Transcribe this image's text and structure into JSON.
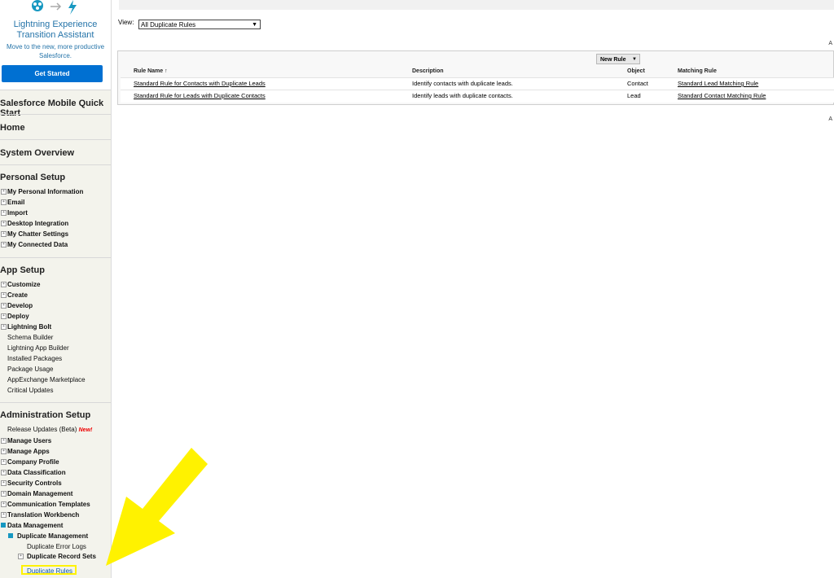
{
  "sidebar": {
    "promo": {
      "title_line1": "Lightning Experience",
      "title_line2": "Transition Assistant",
      "desc_line1": "Move to the new, more productive",
      "desc_line2": "Salesforce.",
      "button": "Get Started"
    },
    "sections": {
      "mobile": "Salesforce Mobile Quick Start",
      "home": "Home",
      "overview": "System Overview",
      "personal": "Personal Setup",
      "app": "App Setup",
      "admin": "Administration Setup"
    },
    "personal_items": [
      "My Personal Information",
      "Email",
      "Import",
      "Desktop Integration",
      "My Chatter Settings",
      "My Connected Data"
    ],
    "app_items": [
      "Customize",
      "Create",
      "Develop",
      "Deploy",
      "Lightning Bolt",
      "Schema Builder",
      "Lightning App Builder",
      "Installed Packages",
      "Package Usage",
      "AppExchange Marketplace",
      "Critical Updates"
    ],
    "admin_items": [
      "Release Updates (Beta)",
      "Manage Users",
      "Manage Apps",
      "Company Profile",
      "Data Classification",
      "Security Controls",
      "Domain Management",
      "Communication Templates",
      "Translation Workbench",
      "Data Management"
    ],
    "new_tag": "New!",
    "dup_mgmt": "Duplicate Management",
    "dup_items": [
      "Duplicate Error Logs",
      "Duplicate Record Sets",
      "Duplicate Rules"
    ]
  },
  "main": {
    "view_label": "View:",
    "view_value": "All Duplicate Rules",
    "corner_a": "A",
    "new_rule": "New Rule",
    "columns": [
      "Rule Name ↑",
      "Description",
      "Object",
      "Matching Rule"
    ],
    "rows": [
      {
        "name": "Standard Rule for Contacts with Duplicate Leads",
        "desc": "Identify contacts with duplicate leads.",
        "object": "Contact",
        "matching": "Standard Lead Matching Rule"
      },
      {
        "name": "Standard Rule for Leads with Duplicate Contacts",
        "desc": "Identify leads with duplicate contacts.",
        "object": "Lead",
        "matching": "Standard Contact Matching Rule"
      }
    ]
  },
  "colors": {
    "accent": "#0070d2",
    "highlight": "#fff200"
  }
}
